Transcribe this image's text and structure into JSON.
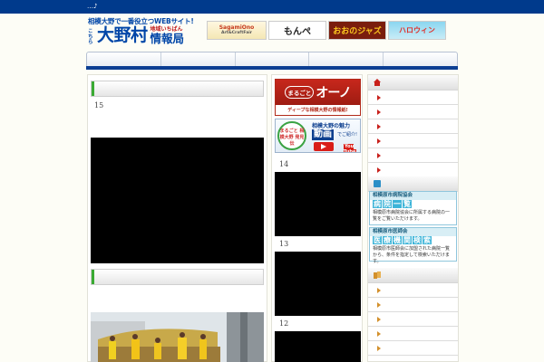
{
  "header": {
    "topbar_text": "…♪",
    "logo": {
      "tagline": "相模大野で一番役立つWEBサイト!",
      "kochira": "こちら",
      "name": "大野村",
      "chiiki": "地域いちばん",
      "joho": "情報局"
    },
    "banners": [
      {
        "title": "SagamiOno",
        "subtitle": "Art&CraftFair"
      },
      {
        "title": "もんぺ"
      },
      {
        "title": "おおのジャズ"
      },
      {
        "title": "ハロウィン"
      }
    ]
  },
  "nav": {
    "items": [
      "",
      "",
      "",
      "",
      ""
    ]
  },
  "left_column": {
    "sections": [
      {
        "number": "15"
      }
    ]
  },
  "center_column": {
    "ono_banner": {
      "badge": "まるごと",
      "name": "オーノ",
      "subtitle": "ディープな相模大野の情報紙!"
    },
    "movie_banner": {
      "circle": "まるごと 相模大野 発見伝",
      "line1": "相模大野の魅力",
      "douga": "動画",
      "gosho": "でご紹介!",
      "youtube": "You Tube"
    },
    "videos": [
      {
        "number": "14"
      },
      {
        "number": "13"
      },
      {
        "number": "12"
      }
    ]
  },
  "right_column": {
    "hospital": {
      "title": "相模原市病院協会",
      "highlight": [
        "病",
        "院",
        "一",
        "覧"
      ],
      "desc": "相模原市病院協会に所属する病院の一覧をご覧いただけます。"
    },
    "doctors": {
      "title": "相模原市医師会",
      "highlight": [
        "医",
        "療",
        "機",
        "関",
        "検",
        "索"
      ],
      "desc": "相模原市医師会に加盟された病院一覧から、条件を指定して検索いただけます。"
    }
  },
  "colors": {
    "brand_blue": "#003a8c",
    "accent_red": "#c8201b",
    "accent_green": "#3aaa33"
  }
}
